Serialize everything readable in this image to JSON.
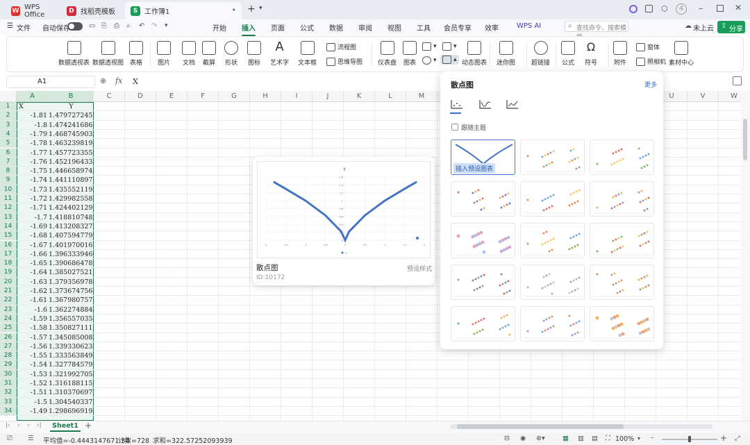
{
  "tabs": [
    {
      "label": "WPS Office",
      "icon": "wps-logo",
      "color": "#e0322b"
    },
    {
      "label": "找稻壳模板",
      "icon": "docer-logo",
      "color": "#d42b3a"
    },
    {
      "label": "工作簿1",
      "icon": "spreadsheet-s",
      "color": "#1a9c5b"
    }
  ],
  "tabbar_right": {
    "badge": "4"
  },
  "menu": {
    "file": "文件",
    "autosave": "自动保存",
    "cloud": "未上云",
    "share": "分享",
    "search_placeholder": "查找命令、搜索模板"
  },
  "ribbon_tabs": [
    {
      "label": "开始"
    },
    {
      "label": "插入",
      "active": true
    },
    {
      "label": "页面"
    },
    {
      "label": "公式"
    },
    {
      "label": "数据"
    },
    {
      "label": "审阅"
    },
    {
      "label": "视图"
    },
    {
      "label": "工具"
    },
    {
      "label": "会员专享"
    },
    {
      "label": "效率"
    },
    {
      "label": "WPS AI"
    }
  ],
  "search_box": "查找命令、搜索模板",
  "ribbon": {
    "pivot_table": "数据透视表",
    "pivot_chart": "数据透视图",
    "table": "表格",
    "picture": "图片",
    "text": "文档",
    "screenshot": "截屏",
    "shape": "形状",
    "icon": "图标",
    "wordart": "艺术字",
    "textbox": "文本框",
    "flowchart": "流程图",
    "mindmap": "思维导图",
    "dashboard": "仪表盘",
    "chart": "图表",
    "dynamic_chart": "动态图表",
    "sparkline": "迷你图",
    "hyperlink": "超链接",
    "formula": "公式",
    "symbol": "符号",
    "attachment": "附件",
    "window": "窗体",
    "camera": "照相机",
    "material": "素材中心"
  },
  "formula_bar": {
    "cell_ref": "A1",
    "fx": "fx",
    "value": "X"
  },
  "columns": [
    "A",
    "B",
    "C",
    "D",
    "E",
    "F",
    "G",
    "H",
    "I",
    "J",
    "K",
    "L",
    "M",
    "N",
    "O",
    "P",
    "Q",
    "R",
    "S",
    "T",
    "U",
    "V",
    "W"
  ],
  "rows": [
    [
      "X",
      "Y"
    ],
    [
      "-1.81",
      "1.479727245"
    ],
    [
      "-1.8",
      "1.474241686"
    ],
    [
      "-1.79",
      "1.468745903"
    ],
    [
      "-1.78",
      "1.463239819"
    ],
    [
      "-1.77",
      "1.457723355"
    ],
    [
      "-1.76",
      "1.452196433"
    ],
    [
      "-1.75",
      "1.446658974"
    ],
    [
      "-1.74",
      "1.441110897"
    ],
    [
      "-1.73",
      "1.435552119"
    ],
    [
      "-1.72",
      "1.429982558"
    ],
    [
      "-1.71",
      "1.424402129"
    ],
    [
      "-1.7",
      "1.418810748"
    ],
    [
      "-1.69",
      "1.413208327"
    ],
    [
      "-1.68",
      "1.407594779"
    ],
    [
      "-1.67",
      "1.401970016"
    ],
    [
      "-1.66",
      "1.396333946"
    ],
    [
      "-1.65",
      "1.390686478"
    ],
    [
      "-1.64",
      "1.385027521"
    ],
    [
      "-1.63",
      "1.379356978"
    ],
    [
      "-1.62",
      "1.373674756"
    ],
    [
      "-1.61",
      "1.367980757"
    ],
    [
      "-1.6",
      "1.362274884"
    ],
    [
      "-1.59",
      "1.356557035"
    ],
    [
      "-1.58",
      "1.350827111"
    ],
    [
      "-1.57",
      "1.345085008"
    ],
    [
      "-1.56",
      "1.339330623"
    ],
    [
      "-1.55",
      "1.333563849"
    ],
    [
      "-1.54",
      "1.327784579"
    ],
    [
      "-1.53",
      "1.321992705"
    ],
    [
      "-1.52",
      "1.316188115"
    ],
    [
      "-1.51",
      "1.310370697"
    ],
    [
      "-1.5",
      "1.304540337"
    ],
    [
      "-1.49",
      "1.298696919"
    ]
  ],
  "preview": {
    "chart_title": "Y",
    "legend": "Y",
    "name": "散点图",
    "style_label": "预设样式",
    "id": "ID:10172",
    "y_ticks": [
      "1.6",
      "1.4",
      "1.2",
      "1",
      "0.8",
      "0.6",
      "0.4",
      "0.2",
      "0"
    ],
    "x_ticks": [
      "-2",
      "-1.5",
      "-1",
      "-0.5",
      "0",
      "0.5",
      "1",
      "1.5",
      "2"
    ]
  },
  "chart_data": {
    "type": "scatter",
    "title": "Y",
    "series": [
      {
        "name": "Y",
        "x": [
          -1.81,
          -1.5,
          -1.0,
          -0.5,
          -0.1,
          0,
          0.1,
          0.5,
          1.0,
          1.5,
          1.81
        ],
        "y": [
          1.48,
          1.3,
          1.0,
          0.63,
          0.22,
          0,
          0.22,
          0.63,
          1.0,
          1.3,
          1.48
        ]
      }
    ],
    "xlim": [
      -2,
      2
    ],
    "ylim": [
      0,
      1.6
    ]
  },
  "dropdown": {
    "title": "散点图",
    "more": "更多",
    "follow_theme": "跟随主题",
    "insert_preset": "插入预设图表"
  },
  "sheet": {
    "name": "Sheet1",
    "add": "+"
  },
  "status": {
    "avg": "平均值=-0.4443147671 34",
    "count": "计数=728",
    "sum": "求和=322.57252093939",
    "zoom": "100%"
  }
}
